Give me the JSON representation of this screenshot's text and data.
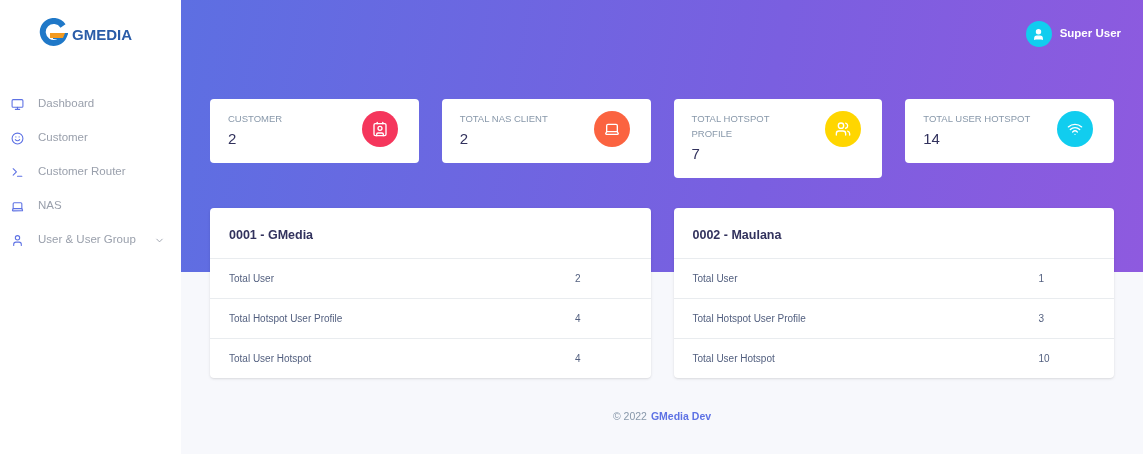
{
  "sidebar": {
    "logo_text": "GMEDIA",
    "items": [
      {
        "label": "Dashboard"
      },
      {
        "label": "Customer"
      },
      {
        "label": "Customer Router"
      },
      {
        "label": "NAS"
      },
      {
        "label": "User & User Group",
        "expanded": false
      }
    ]
  },
  "header": {
    "user": "Super User"
  },
  "stats": [
    {
      "label": "CUSTOMER",
      "value": "2",
      "color": "#f5365c"
    },
    {
      "label": "TOTAL NAS CLIENT",
      "value": "2",
      "color": "#fb6340"
    },
    {
      "label": "TOTAL HOTSPOT PROFILE",
      "value": "7",
      "color": "#ffd600"
    },
    {
      "label": "TOTAL USER HOTSPOT",
      "value": "14",
      "color": "#11cdef"
    }
  ],
  "groups": [
    {
      "title": "0001 - GMedia",
      "rows": [
        {
          "label": "Total User",
          "value": "2"
        },
        {
          "label": "Total Hotspot User Profile",
          "value": "4"
        },
        {
          "label": "Total User Hotspot",
          "value": "4"
        }
      ]
    },
    {
      "title": "0002 - Maulana",
      "rows": [
        {
          "label": "Total User",
          "value": "1"
        },
        {
          "label": "Total Hotspot User Profile",
          "value": "3"
        },
        {
          "label": "Total User Hotspot",
          "value": "10"
        }
      ]
    }
  ],
  "footer": {
    "copyright": "© 2022",
    "link": "GMedia Dev"
  }
}
